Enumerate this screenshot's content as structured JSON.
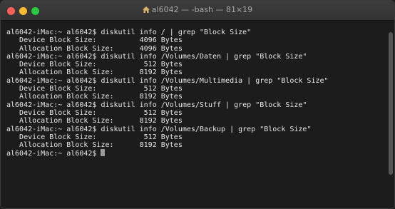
{
  "window": {
    "title": "al6042 — -bash — 81×19"
  },
  "terminal": {
    "lines": [
      "al6042-iMac:~ al6042$ diskutil info / | grep \"Block Size\"",
      "   Device Block Size:          4096 Bytes",
      "   Allocation Block Size:      4096 Bytes",
      "al6042-iMac:~ al6042$ diskutil info /Volumes/Daten | grep \"Block Size\"",
      "   Device Block Size:           512 Bytes",
      "   Allocation Block Size:      8192 Bytes",
      "al6042-iMac:~ al6042$ diskutil info /Volumes/Multimedia | grep \"Block Size\"",
      "   Device Block Size:           512 Bytes",
      "   Allocation Block Size:      8192 Bytes",
      "al6042-iMac:~ al6042$ diskutil info /Volumes/Stuff | grep \"Block Size\"",
      "   Device Block Size:           512 Bytes",
      "   Allocation Block Size:      8192 Bytes",
      "al6042-iMac:~ al6042$ diskutil info /Volumes/Backup | grep \"Block Size\"",
      "   Device Block Size:           512 Bytes",
      "   Allocation Block Size:      8192 Bytes"
    ],
    "prompt": "al6042-iMac:~ al6042$ "
  },
  "colors": {
    "close": "#fc5f57",
    "minimize": "#fdbc2e",
    "maximize": "#28c840",
    "background": "#1c1c1c",
    "text": "#e8e8e8"
  },
  "icons": {
    "title_icon": "home-icon"
  }
}
